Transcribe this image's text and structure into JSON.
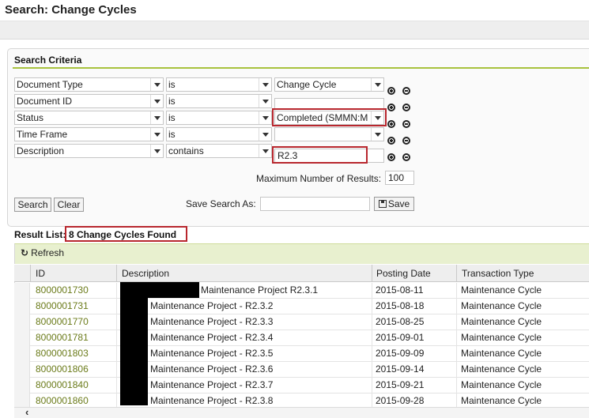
{
  "page": {
    "title": "Search: Change Cycles"
  },
  "criteria": {
    "title": "Search Criteria",
    "rows": [
      {
        "field": "Document Type",
        "operator": "is",
        "value": "Change Cycle"
      },
      {
        "field": "Document ID",
        "operator": "is",
        "value": ""
      },
      {
        "field": "Status",
        "operator": "is",
        "value": "Completed (SMMN:M"
      },
      {
        "field": "Time Frame",
        "operator": "is",
        "value": ""
      },
      {
        "field": "Description",
        "operator": "contains",
        "value": "R2.3"
      }
    ],
    "max_results_label": "Maximum Number of Results:",
    "max_results_value": "100",
    "search_label": "Search",
    "clear_label": "Clear",
    "save_search_label": "Save Search As:",
    "save_search_value": "",
    "save_label": "Save"
  },
  "results": {
    "label": "Result List:",
    "count_text": "8 Change Cycles Found",
    "refresh_label": "Refresh",
    "columns": [
      "ID",
      "Description",
      "Posting Date",
      "Transaction Type"
    ],
    "rows": [
      {
        "id": "8000001730",
        "description": "Maintenance Project R2.3.1",
        "date": "2015-08-11",
        "type": "Maintenance Cycle"
      },
      {
        "id": "8000001731",
        "description": "Maintenance Project - R2.3.2",
        "date": "2015-08-18",
        "type": "Maintenance Cycle"
      },
      {
        "id": "8000001770",
        "description": "Maintenance Project - R2.3.3",
        "date": "2015-08-25",
        "type": "Maintenance Cycle"
      },
      {
        "id": "8000001781",
        "description": "Maintenance Project - R2.3.4",
        "date": "2015-09-01",
        "type": "Maintenance Cycle"
      },
      {
        "id": "8000001803",
        "description": "Maintenance Project - R2.3.5",
        "date": "2015-09-09",
        "type": "Maintenance Cycle"
      },
      {
        "id": "8000001806",
        "description": "Maintenance Project - R2.3.6",
        "date": "2015-09-14",
        "type": "Maintenance Cycle"
      },
      {
        "id": "8000001840",
        "description": "Maintenance Project - R2.3.7",
        "date": "2015-09-21",
        "type": "Maintenance Cycle"
      },
      {
        "id": "8000001860",
        "description": "Maintenance Project - R2.3.8",
        "date": "2015-09-28",
        "type": "Maintenance Cycle"
      }
    ]
  },
  "colors": {
    "accent": "#a8c23e",
    "highlight": "#b8272e",
    "link": "#6b7b1a",
    "toolbar": "#e8f0cf"
  },
  "icons": {
    "refresh": "refresh-icon",
    "save": "floppy-disk-icon",
    "add": "add-circle-icon",
    "remove": "remove-circle-icon",
    "dropdown": "chevron-down-icon"
  }
}
